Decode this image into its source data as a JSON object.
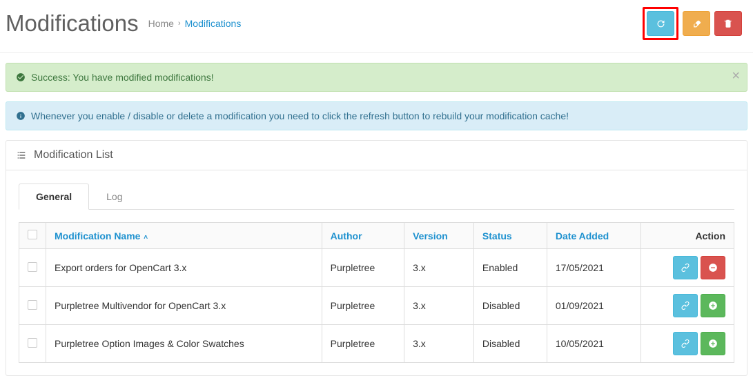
{
  "header": {
    "title": "Modifications",
    "breadcrumb_home": "Home",
    "breadcrumb_current": "Modifications"
  },
  "alerts": {
    "success": "Success: You have modified modifications!",
    "info": "Whenever you enable / disable or delete a modification you need to click the refresh button to rebuild your modification cache!"
  },
  "panel": {
    "heading": "Modification List",
    "tabs": {
      "general": "General",
      "log": "Log"
    }
  },
  "table": {
    "columns": {
      "name": "Modification Name",
      "author": "Author",
      "version": "Version",
      "status": "Status",
      "date_added": "Date Added",
      "action": "Action"
    },
    "rows": [
      {
        "name": "Export orders for OpenCart 3.x",
        "author": "Purpletree",
        "version": "3.x",
        "status": "Enabled",
        "date_added": "17/05/2021",
        "action": "disable"
      },
      {
        "name": "Purpletree Multivendor for OpenCart 3.x",
        "author": "Purpletree",
        "version": "3.x",
        "status": "Disabled",
        "date_added": "01/09/2021",
        "action": "enable"
      },
      {
        "name": "Purpletree Option Images & Color Swatches",
        "author": "Purpletree",
        "version": "3.x",
        "status": "Disabled",
        "date_added": "10/05/2021",
        "action": "enable"
      }
    ]
  }
}
